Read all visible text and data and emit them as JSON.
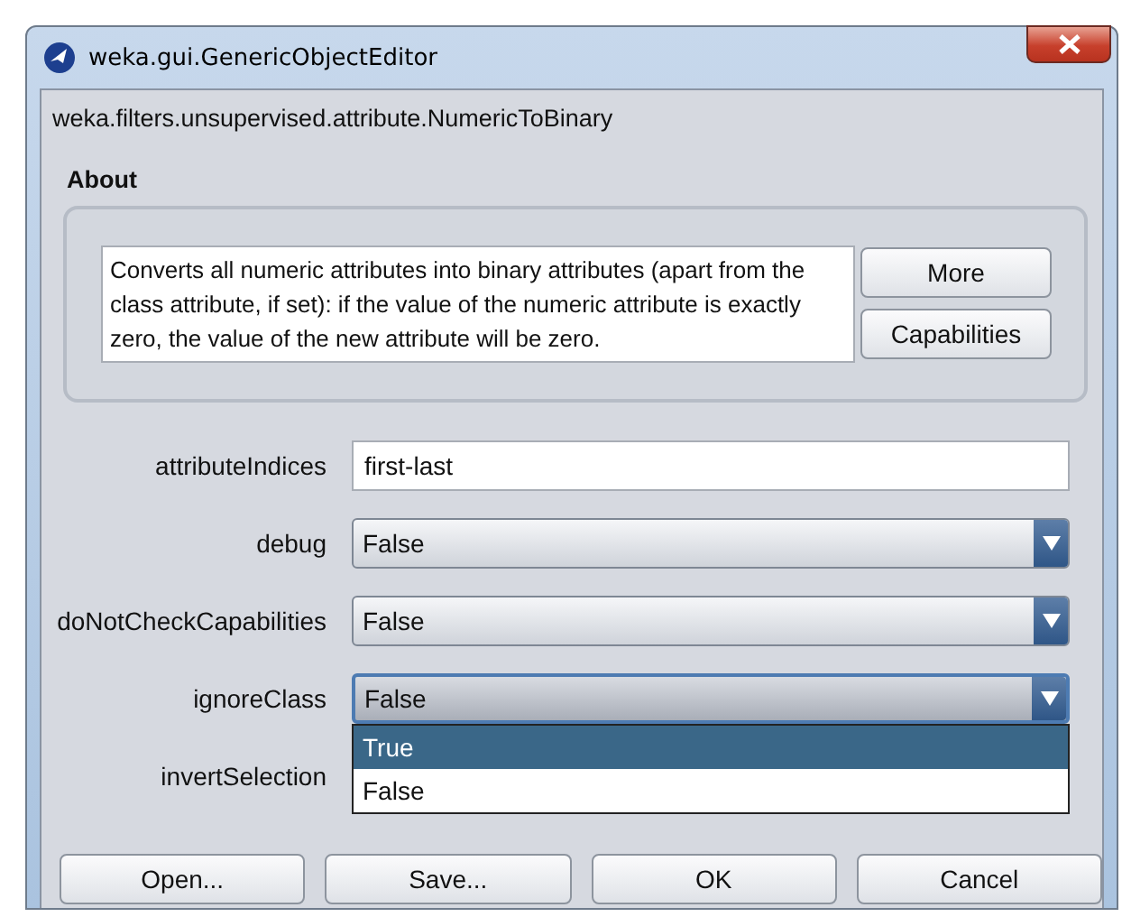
{
  "window": {
    "title": "weka.gui.GenericObjectEditor"
  },
  "class_name": "weka.filters.unsupervised.attribute.NumericToBinary",
  "about": {
    "heading": "About",
    "text": "Converts all numeric attributes into binary attributes (apart from the class attribute, if set): if the value of the numeric attribute is exactly zero, the value of the new attribute will be zero.",
    "buttons": [
      "More",
      "Capabilities"
    ]
  },
  "properties": [
    {
      "kind": "text",
      "label": "attributeIndices",
      "value": "first-last"
    },
    {
      "kind": "dropdown",
      "label": "debug",
      "value": "False",
      "focused": false
    },
    {
      "kind": "dropdown",
      "label": "doNotCheckCapabilities",
      "value": "False",
      "focused": false
    },
    {
      "kind": "dropdown",
      "label": "ignoreClass",
      "value": "False",
      "focused": true,
      "open_list": [
        {
          "label": "True",
          "highlighted": true
        },
        {
          "label": "False",
          "highlighted": false
        }
      ]
    },
    {
      "kind": "hidden",
      "label": "invertSelection"
    }
  ],
  "buttons": [
    "Open...",
    "Save...",
    "OK",
    "Cancel"
  ]
}
